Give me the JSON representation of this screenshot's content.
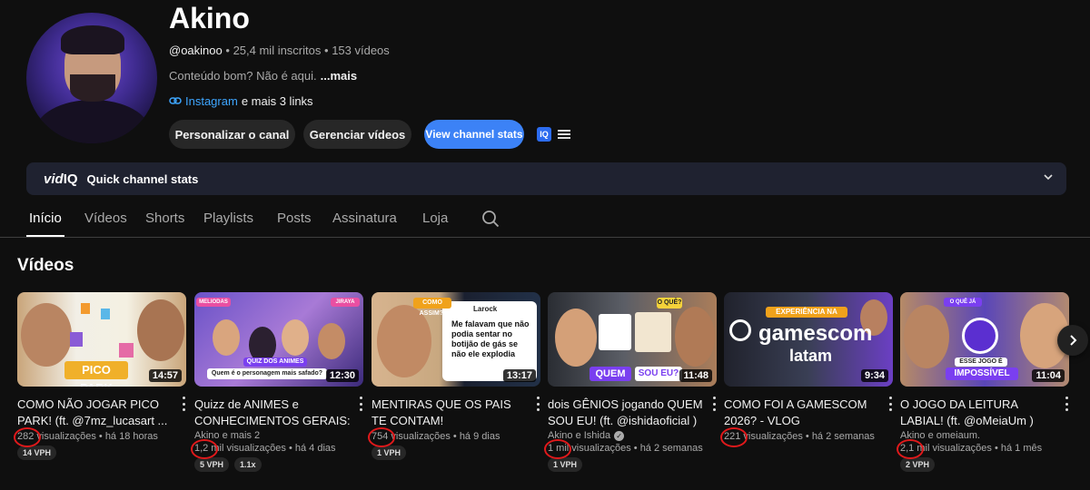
{
  "channel": {
    "name": "Akino",
    "handle": "@oakinoo",
    "subscribers": "25,4 mil inscritos",
    "video_count": "153 vídeos",
    "separator": "•",
    "description": "Conteúdo bom? Não é aqui.",
    "more_label": "...mais",
    "link_label": "Instagram",
    "more_links": "e mais 3 links"
  },
  "actions": {
    "customize": "Personalizar o canal",
    "manage": "Gerenciar vídeos",
    "stats": "View channel stats",
    "vidiq_badge": "IQ"
  },
  "vidiq": {
    "logo_prefix": "vid",
    "logo_suffix": "IQ",
    "title": "Quick channel stats"
  },
  "tabs": [
    {
      "label": "Início",
      "active": true
    },
    {
      "label": "Vídeos"
    },
    {
      "label": "Shorts"
    },
    {
      "label": "Playlists"
    },
    {
      "label": "Posts"
    },
    {
      "label": "Assinatura"
    },
    {
      "label": "Loja"
    }
  ],
  "section": {
    "title": "Vídeos"
  },
  "videos": [
    {
      "title": "COMO NÃO JOGAR PICO PARK! (ft. @7mz_lucasart ...",
      "author": "",
      "views": "282",
      "views_suffix": "visualizações",
      "age": "há 18 horas",
      "duration": "14:57",
      "badges": [
        "14 VPH"
      ],
      "thumb_text": "PICO PARK"
    },
    {
      "title": "Quizz de ANIMES e CONHECIMENTOS GERAIS: ...",
      "author": "Akino e mais 2",
      "views": "1,2 mil",
      "views_suffix": "visualizações",
      "age": "há 4 dias",
      "duration": "12:30",
      "badges": [
        "5 VPH",
        "1.1x"
      ],
      "thumb_text": "QUIZ DOS ANIMES",
      "thumb_sub": "Quem é o personagem mais safado?",
      "thumb_tag_left": "MELIODAS",
      "thumb_tag_right": "JIRAYA"
    },
    {
      "title": "MENTIRAS QUE OS PAIS TE CONTAM!",
      "author": "",
      "views": "754",
      "views_suffix": "visualizações",
      "age": "há 9 dias",
      "duration": "13:17",
      "badges": [
        "1 VPH"
      ],
      "thumb_text": "Me falavam que não podia sentar no botijão de gás se não ele explodia",
      "thumb_tag": "COMO ASSIM?!",
      "thumb_user": "Larock"
    },
    {
      "title": "dois GÊNIOS jogando QUEM SOU EU! (ft. @ishidaoficial )",
      "author": "Akino e Ishida",
      "verified": true,
      "views": "1 mil",
      "views_suffix": "visualizações",
      "age": "há 2 semanas",
      "duration": "11:48",
      "badges": [
        "1 VPH"
      ],
      "thumb_text": "QUEM",
      "thumb_text2": "SOU EU?",
      "thumb_tag": "O QUÊ?"
    },
    {
      "title": "COMO FOI A GAMESCOM 2026? - VLOG",
      "author": "",
      "views": "221",
      "views_suffix": "visualizações",
      "age": "há 2 semanas",
      "duration": "9:34",
      "badges": [],
      "thumb_text": "gamescom",
      "thumb_text2": "latam",
      "thumb_tag": "EXPERIÊNCIA NA"
    },
    {
      "title": "O JOGO DA LEITURA LABIAL! (ft. @oMeiaUm )",
      "author": "Akino e omeiaum.",
      "views": "2,1 mil",
      "views_suffix": "visualizações",
      "age": "há 1 mês",
      "duration": "11:04",
      "badges": [
        "2 VPH"
      ],
      "thumb_text": "IMPOSSÍVEL",
      "thumb_tag": "ESSE JOGO É",
      "thumb_tag2": "O QUÊ JÁ"
    }
  ]
}
